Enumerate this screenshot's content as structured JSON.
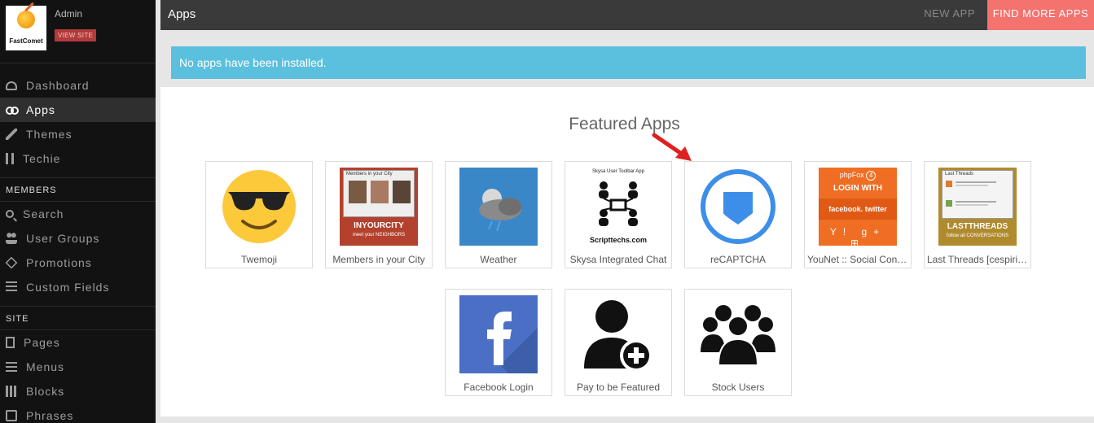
{
  "sidebar": {
    "logo_text": "FastComet",
    "admin_name": "Admin",
    "view_site": "VIEW SITE",
    "nav_main": [
      {
        "label": "Dashboard",
        "icon": "dashboard-icon"
      },
      {
        "label": "Apps",
        "icon": "apps-icon",
        "active": true
      },
      {
        "label": "Themes",
        "icon": "brush-icon"
      },
      {
        "label": "Techie",
        "icon": "techie-icon"
      }
    ],
    "section_members": "MEMBERS",
    "nav_members": [
      {
        "label": "Search",
        "icon": "search-icon"
      },
      {
        "label": "User Groups",
        "icon": "user-groups-icon"
      },
      {
        "label": "Promotions",
        "icon": "diamond-icon"
      },
      {
        "label": "Custom Fields",
        "icon": "list-icon"
      }
    ],
    "section_site": "SITE",
    "nav_site": [
      {
        "label": "Pages",
        "icon": "page-icon"
      },
      {
        "label": "Menus",
        "icon": "menu-icon"
      },
      {
        "label": "Blocks",
        "icon": "blocks-icon"
      },
      {
        "label": "Phrases",
        "icon": "phrases-icon"
      }
    ]
  },
  "topbar": {
    "title": "Apps",
    "new_app": "NEW APP",
    "find_more": "FIND MORE APPS"
  },
  "notice": "No apps have been installed.",
  "featured": {
    "title": "Featured Apps",
    "apps": [
      {
        "name": "Twemoji"
      },
      {
        "name": "Members in your City",
        "thumb_title": "Members in your City",
        "thumb_footer_1": "INYOURCITY",
        "thumb_footer_2": "meet your NEIGHBORS"
      },
      {
        "name": "Weather"
      },
      {
        "name": "Skysa Integrated Chat",
        "thumb_title": "Skysa User Toolbar App",
        "thumb_footer": "Scripttechs.com"
      },
      {
        "name": "reCAPTCHA"
      },
      {
        "name": "YouNet :: Social Connect",
        "thumb_line_1": "phpFox",
        "thumb_badge": "4",
        "thumb_line_2": "LOGIN WITH",
        "thumb_line_3": "facebook. twitter"
      },
      {
        "name": "Last Threads [cespiritual]",
        "thumb_title": "Last Threads",
        "thumb_footer_1": "LASTTHREADS",
        "thumb_footer_2": "follow all CONVERSATIONS"
      },
      {
        "name": "Facebook Login"
      },
      {
        "name": "Pay to be Featured"
      },
      {
        "name": "Stock Users"
      }
    ]
  },
  "colors": {
    "sidebar_bg": "#121212",
    "topbar_bg": "#3a3a3a",
    "accent": "#f4736f",
    "notice_bg": "#5bc0de"
  }
}
